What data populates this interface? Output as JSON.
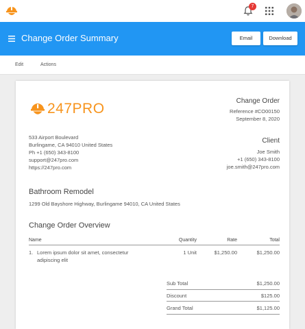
{
  "app": {
    "notification_count": "7",
    "brand_color": "#2196f3",
    "logo_color": "#f7941d",
    "icons": [
      "247pro-logo-icon",
      "bell-icon",
      "apps-grid-icon",
      "avatar",
      "menu-icon"
    ]
  },
  "header": {
    "title": "Change Order Summary",
    "email_label": "Email",
    "download_label": "Download"
  },
  "menu": {
    "edit_label": "Edit",
    "actions_label": "Actions"
  },
  "doc": {
    "logo_text": "247PRO",
    "heading": "Change Order",
    "reference": "Reference #CO00150",
    "date": "September 8, 2020",
    "company": {
      "line1": "533 Airport Boulevard",
      "line2": "Burlingame, CA 94010 United States",
      "phone": "Ph +1 (650) 343-8100",
      "email": "support@247pro.com",
      "website": "https://247pro.com"
    },
    "client": {
      "heading": "Client",
      "name": "Joe Smith",
      "phone": "+1 (650) 343-8100",
      "email": "joe.smith@247pro.com"
    },
    "project": {
      "title": "Bathroom Remodel",
      "address": "1299 Old Bayshore Highway, Burlingame 94010, CA United States"
    },
    "overview_title": "Change Order Overview",
    "table": {
      "headers": {
        "name": "Name",
        "quantity": "Quantity",
        "rate": "Rate",
        "total": "Total"
      },
      "rows": [
        {
          "index": "1.",
          "name_line1": "Lorem ipsum dolor sit amet, consectetur",
          "name_line2": "adipiscing elit",
          "quantity": "1 Unit",
          "rate": "$1,250.00",
          "total": "$1,250.00"
        }
      ]
    },
    "summary": {
      "subtotal_label": "Sub Total",
      "subtotal_value": "$1,250.00",
      "discount_label": "Discount",
      "discount_value": "$125.00",
      "grand_label": "Grand Total",
      "grand_value": "$1,125.00"
    }
  }
}
